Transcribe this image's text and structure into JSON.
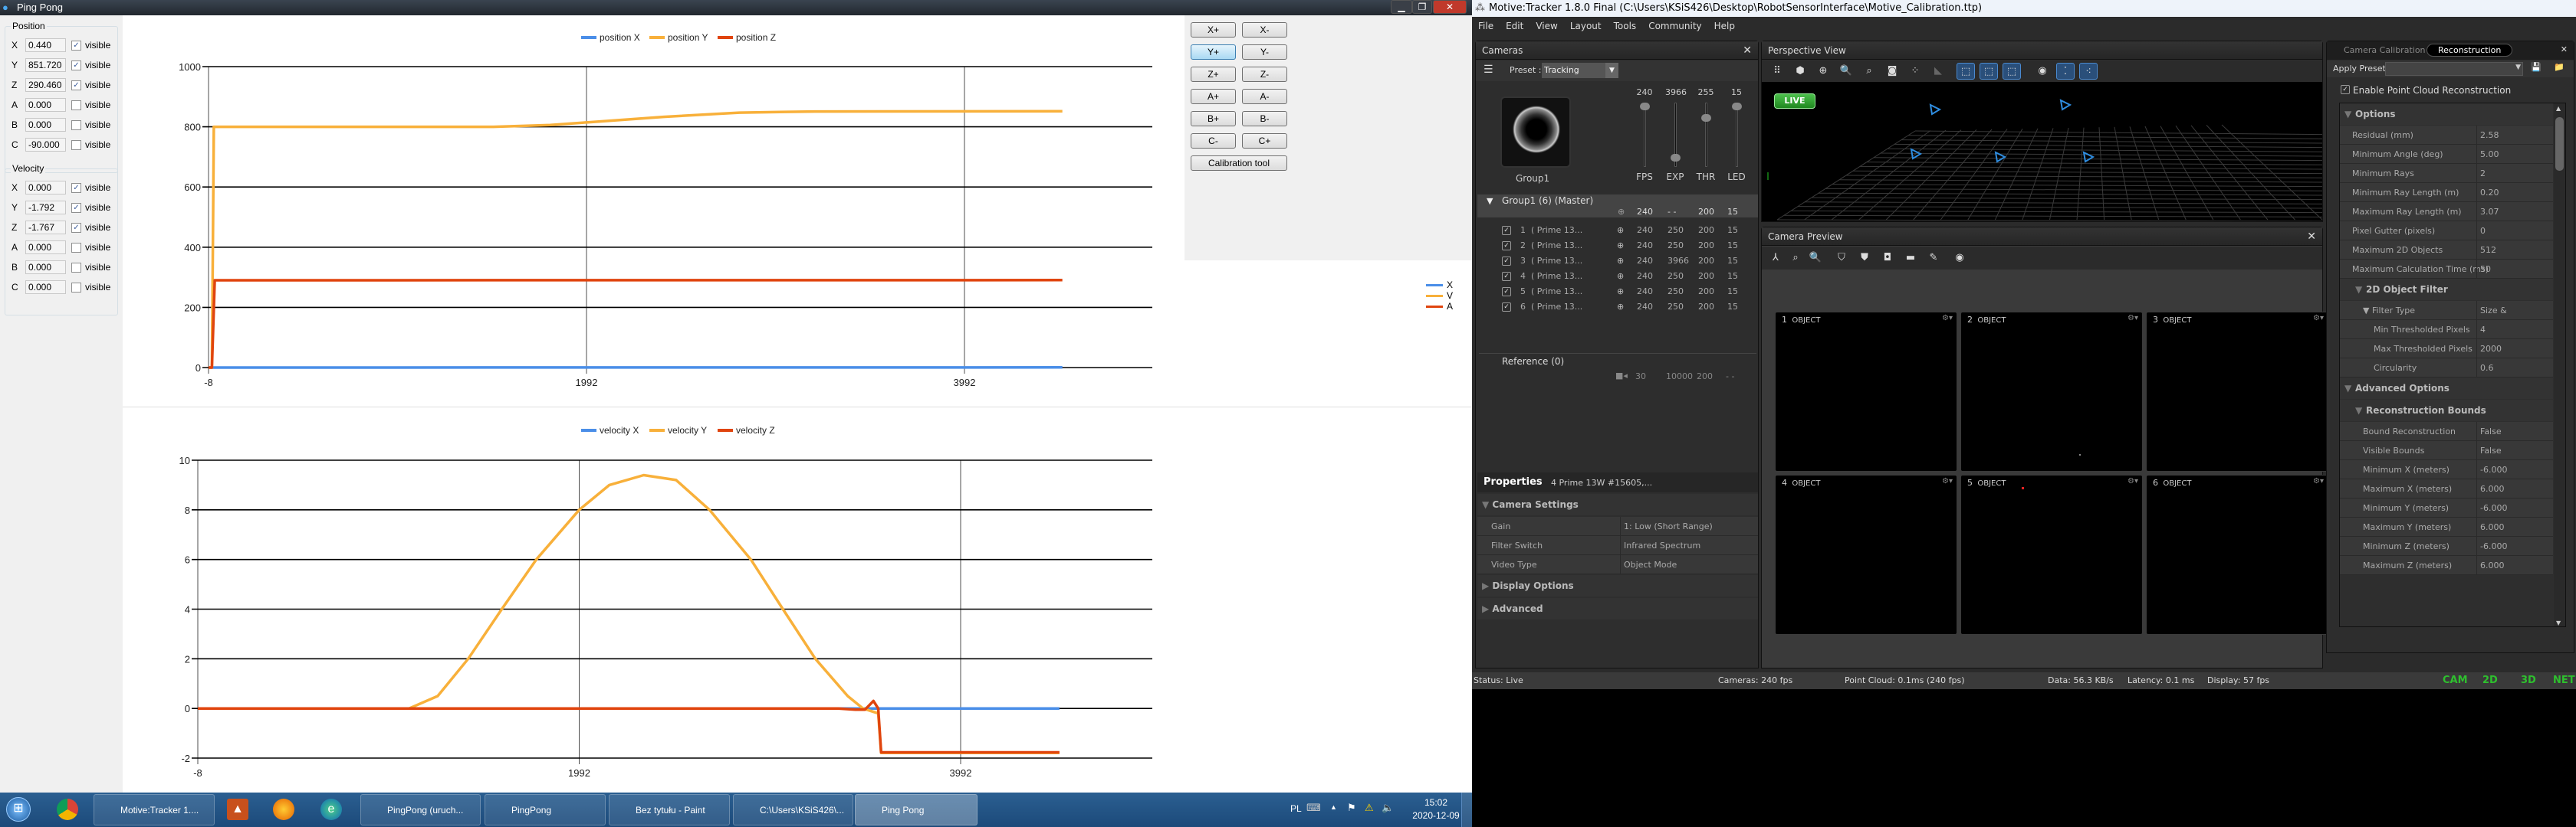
{
  "pingpong": {
    "title": "Ping Pong",
    "position_label": "Position",
    "velocity_label": "Velocity",
    "visible_label": "visible",
    "position": [
      {
        "axis": "X",
        "value": "0.440",
        "checked": true
      },
      {
        "axis": "Y",
        "value": "851.720",
        "checked": true
      },
      {
        "axis": "Z",
        "value": "290.460",
        "checked": true
      },
      {
        "axis": "A",
        "value": "0.000",
        "checked": false
      },
      {
        "axis": "B",
        "value": "0.000",
        "checked": false
      },
      {
        "axis": "C",
        "value": "-90.000",
        "checked": false
      }
    ],
    "velocity": [
      {
        "axis": "X",
        "value": "0.000",
        "checked": true
      },
      {
        "axis": "Y",
        "value": "-1.792",
        "checked": true
      },
      {
        "axis": "Z",
        "value": "-1.767",
        "checked": true
      },
      {
        "axis": "A",
        "value": "0.000",
        "checked": false
      },
      {
        "axis": "B",
        "value": "0.000",
        "checked": false
      },
      {
        "axis": "C",
        "value": "0.000",
        "checked": false
      }
    ],
    "buttons": [
      [
        "X+",
        "X-"
      ],
      [
        "Y+",
        "Y-"
      ],
      [
        "Z+",
        "Z-"
      ],
      [
        "A+",
        "A-"
      ],
      [
        "B+",
        "B-"
      ],
      [
        "C-",
        "C+"
      ]
    ],
    "calibration_label": "Calibration tool",
    "side_legend": [
      {
        "label": "X",
        "color": "#4a8ee8"
      },
      {
        "label": "V",
        "color": "#f8b03a"
      },
      {
        "label": "A",
        "color": "#e0440e"
      }
    ]
  },
  "chart_data": [
    {
      "type": "line",
      "title": "",
      "xlabel": "",
      "ylabel": "",
      "xlim": [
        -8,
        4510
      ],
      "ylim": [
        0,
        1000
      ],
      "xticks": [
        "-8",
        "1992",
        "3992"
      ],
      "yticks": [
        "0",
        "200",
        "400",
        "600",
        "800",
        "1000"
      ],
      "legend_position": "top-center",
      "grid": true,
      "series": [
        {
          "name": "position X",
          "color": "#4a8ee8",
          "points": [
            [
              -8,
              0
            ],
            [
              4510,
              0.44
            ]
          ]
        },
        {
          "name": "position Y",
          "color": "#f8b03a",
          "points": [
            [
              -8,
              0
            ],
            [
              10,
              0
            ],
            [
              20,
              800
            ],
            [
              1500,
              800
            ],
            [
              1800,
              806
            ],
            [
              2000,
              815
            ],
            [
              2400,
              833
            ],
            [
              2800,
              847
            ],
            [
              3200,
              851
            ],
            [
              4510,
              851.72
            ]
          ]
        },
        {
          "name": "position Z",
          "color": "#e0440e",
          "points": [
            [
              -8,
              0
            ],
            [
              10,
              0
            ],
            [
              25,
              290
            ],
            [
              4510,
              290.46
            ]
          ]
        }
      ]
    },
    {
      "type": "line",
      "title": "",
      "xlabel": "",
      "ylabel": "",
      "xlim": [
        -8,
        4510
      ],
      "ylim": [
        -2,
        10
      ],
      "xticks": [
        "-8",
        "1992",
        "3992"
      ],
      "yticks": [
        "-2",
        "0",
        "2",
        "4",
        "6",
        "8",
        "10"
      ],
      "legend_position": "top-center",
      "grid": true,
      "series": [
        {
          "name": "velocity X",
          "color": "#4a8ee8",
          "points": [
            [
              -8,
              0
            ],
            [
              4510,
              0
            ]
          ]
        },
        {
          "name": "velocity Y",
          "color": "#f8b03a",
          "points": [
            [
              -8,
              0
            ],
            [
              1100,
              0
            ],
            [
              1250,
              0.5
            ],
            [
              1410,
              2
            ],
            [
              1586,
              4
            ],
            [
              1767,
              6
            ],
            [
              1992,
              8
            ],
            [
              2150,
              9
            ],
            [
              2330,
              9.4
            ],
            [
              2500,
              9.2
            ],
            [
              2675,
              8
            ],
            [
              2892,
              6
            ],
            [
              3060,
              4
            ],
            [
              3230,
              2
            ],
            [
              3400,
              0.5
            ],
            [
              3480,
              0
            ],
            [
              3560,
              -0.2
            ],
            [
              3575,
              -1.79
            ],
            [
              4510,
              -1.79
            ]
          ]
        },
        {
          "name": "velocity Z",
          "color": "#e0440e",
          "points": [
            [
              -8,
              0
            ],
            [
              3350,
              0
            ],
            [
              3440,
              -0.05
            ],
            [
              3490,
              -0.05
            ],
            [
              3535,
              0.3
            ],
            [
              3560,
              0
            ],
            [
              3575,
              -1.77
            ],
            [
              4510,
              -1.77
            ]
          ]
        }
      ]
    }
  ],
  "taskbar": {
    "items": [
      "Motive:Tracker 1....",
      "PingPong (uruch...",
      "PingPong",
      "Bez tytułu - Paint",
      "C:\\Users\\KSiS426\\...",
      "Ping Pong"
    ],
    "lang": "PL",
    "time": "15:02",
    "date": "2020-12-09"
  },
  "motive": {
    "title": "Motive:Tracker 1.8.0 Final (C:\\Users\\KSiS426\\Desktop\\RobotSensorInterface\\Motive_Calibration.ttp)",
    "menu": [
      "File",
      "Edit",
      "View",
      "Layout",
      "Tools",
      "Community",
      "Help"
    ],
    "cameras": {
      "title": "Cameras",
      "preset_label": "Preset :",
      "preset_value": "Tracking",
      "group_label": "Group1",
      "sliders": [
        {
          "label": "FPS",
          "value": "240",
          "level": 1.0
        },
        {
          "label": "EXP",
          "value": "3966",
          "level": 0.12
        },
        {
          "label": "THR",
          "value": "255",
          "level": 0.8
        },
        {
          "label": "LED",
          "value": "15",
          "level": 1.0
        }
      ],
      "group_header": "Group1 (6) (Master)",
      "group_summary": [
        "240",
        "- -",
        "200",
        "15"
      ],
      "rows": [
        {
          "num": "1",
          "name": "( Prime 13...",
          "fps": "240",
          "exp": "250",
          "thr": "200",
          "led": "15"
        },
        {
          "num": "2",
          "name": "( Prime 13...",
          "fps": "240",
          "exp": "250",
          "thr": "200",
          "led": "15"
        },
        {
          "num": "3",
          "name": "( Prime 13...",
          "fps": "240",
          "exp": "3966",
          "thr": "200",
          "led": "15"
        },
        {
          "num": "4",
          "name": "( Prime 13...",
          "fps": "240",
          "exp": "250",
          "thr": "200",
          "led": "15"
        },
        {
          "num": "5",
          "name": "( Prime 13...",
          "fps": "240",
          "exp": "250",
          "thr": "200",
          "led": "15"
        },
        {
          "num": "6",
          "name": "( Prime 13...",
          "fps": "240",
          "exp": "250",
          "thr": "200",
          "led": "15"
        }
      ],
      "reference_label": "Reference (0)",
      "reference_values": [
        "30",
        "10000",
        "200",
        "- -"
      ]
    },
    "properties": {
      "title": "Properties",
      "subtitle": "4 Prime 13W #15605,...",
      "camera_settings": "Camera Settings",
      "rows": [
        {
          "label": "Gain",
          "value": "1: Low (Short Range)"
        },
        {
          "label": "Filter Switch",
          "value": "Infrared Spectrum"
        },
        {
          "label": "Video Type",
          "value": "Object Mode"
        }
      ],
      "display_options": "Display Options",
      "advanced": "Advanced"
    },
    "perspective": {
      "title": "Perspective View",
      "live": "LIVE"
    },
    "preview": {
      "title": "Camera Preview",
      "tiles": [
        {
          "num": "1",
          "mode": "OBJECT"
        },
        {
          "num": "2",
          "mode": "OBJECT"
        },
        {
          "num": "3",
          "mode": "OBJECT"
        },
        {
          "num": "4",
          "mode": "OBJECT"
        },
        {
          "num": "5",
          "mode": "OBJECT"
        },
        {
          "num": "6",
          "mode": "OBJECT"
        }
      ]
    },
    "reconstruction": {
      "tabs": [
        "Camera Calibration",
        "Reconstruction"
      ],
      "apply_preset": "Apply Preset",
      "enable_label": "Enable Point Cloud Reconstruction",
      "rows": [
        {
          "type": "header",
          "level": 0,
          "label": "Options"
        },
        {
          "type": "row",
          "level": 0,
          "label": "Residual (mm)",
          "value": "2.58"
        },
        {
          "type": "row",
          "level": 0,
          "label": "Minimum Angle (deg)",
          "value": "5.00"
        },
        {
          "type": "row",
          "level": 0,
          "label": "Minimum Rays",
          "value": "2"
        },
        {
          "type": "row",
          "level": 0,
          "label": "Minimum Ray Length (m)",
          "value": "0.20"
        },
        {
          "type": "row",
          "level": 0,
          "label": "Maximum Ray Length (m)",
          "value": "3.07"
        },
        {
          "type": "row",
          "level": 0,
          "label": "Pixel Gutter (pixels)",
          "value": "0"
        },
        {
          "type": "row",
          "level": 0,
          "label": "Maximum 2D Objects",
          "value": "512"
        },
        {
          "type": "row",
          "level": 0,
          "label": "Maximum Calculation Time (ms)",
          "value": "50"
        },
        {
          "type": "header",
          "level": 1,
          "label": "2D Object Filter"
        },
        {
          "type": "row",
          "level": 1,
          "label": "▼ Filter Type",
          "value": "Size & Roundness"
        },
        {
          "type": "row",
          "level": 2,
          "label": "Min Thresholded Pixels",
          "value": "4"
        },
        {
          "type": "row",
          "level": 2,
          "label": "Max Thresholded Pixels",
          "value": "2000"
        },
        {
          "type": "row",
          "level": 2,
          "label": "Circularity",
          "value": "0.6"
        },
        {
          "type": "header",
          "level": 0,
          "label": "Advanced Options"
        },
        {
          "type": "header",
          "level": 1,
          "label": "Reconstruction Bounds"
        },
        {
          "type": "row",
          "level": 1,
          "label": "Bound Reconstruction",
          "value": "False"
        },
        {
          "type": "row",
          "level": 1,
          "label": "Visible Bounds",
          "value": "False"
        },
        {
          "type": "row",
          "level": 1,
          "label": "Minimum X (meters)",
          "value": "-6.000"
        },
        {
          "type": "row",
          "level": 1,
          "label": "Maximum X (meters)",
          "value": "6.000"
        },
        {
          "type": "row",
          "level": 1,
          "label": "Minimum Y (meters)",
          "value": "-6.000"
        },
        {
          "type": "row",
          "level": 1,
          "label": "Maximum Y (meters)",
          "value": "6.000"
        },
        {
          "type": "row",
          "level": 1,
          "label": "Minimum Z (meters)",
          "value": "-6.000"
        },
        {
          "type": "row",
          "level": 1,
          "label": "Maximum Z (meters)",
          "value": "6.000"
        }
      ]
    },
    "status": {
      "status": "Status: Live",
      "cameras": "Cameras: 240 fps",
      "point_cloud": "Point Cloud: 0.1ms (240 fps)",
      "data": "Data: 56.3 KB/s",
      "latency": "Latency: 0.1 ms",
      "display": "Display: 57 fps",
      "indicators": [
        "CAM",
        "2D",
        "3D",
        "NET"
      ]
    }
  }
}
